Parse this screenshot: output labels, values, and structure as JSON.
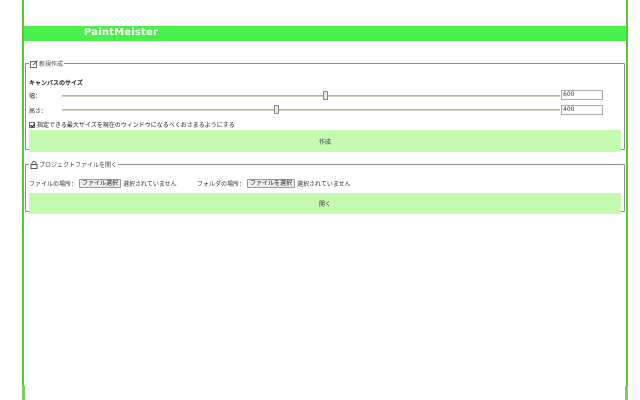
{
  "app": {
    "title": "PaintMeister"
  },
  "new_section": {
    "legend": "新規作成",
    "canvas_size_label": "キャンバスのサイズ",
    "width": {
      "label": "幅：",
      "value": "600",
      "slider_fraction": 0.53
    },
    "height": {
      "label": "高さ：",
      "value": "400",
      "slider_fraction": 0.43
    },
    "fit_window": {
      "label": "指定できる最大サイズを現在のウィンドウになるべくおさまるようにする",
      "checked": true
    },
    "create_button": "作成"
  },
  "open_section": {
    "legend": "プロジェクトファイルを開く",
    "file_location_label": "ファイルの場所：",
    "file_button": "ファイル選択",
    "file_status": "選択されていません",
    "folder_location_label": "フォルダの場所：",
    "folder_button": "ファイルを選択",
    "folder_status": "選択されていません",
    "open_button": "開く"
  },
  "colors": {
    "accent": "#4cf04c",
    "button_bg": "#c4fbb0",
    "frame": "#55c93a"
  },
  "icons": {
    "new": "edit-icon",
    "open": "lock-icon"
  }
}
